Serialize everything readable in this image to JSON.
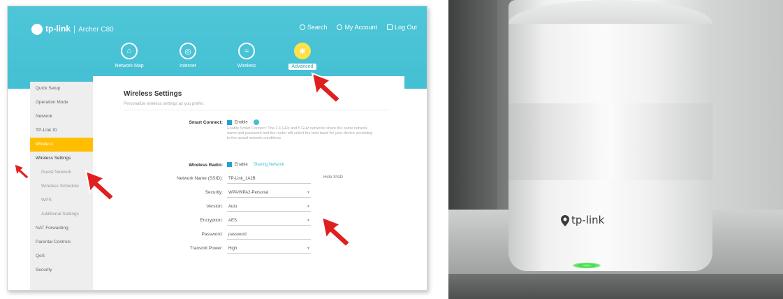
{
  "router_ui": {
    "brand": "tp-link",
    "model": "Archer C80",
    "top_actions": [
      "Search",
      "My Account",
      "Log Out"
    ],
    "tabs": [
      {
        "label": "Network Map"
      },
      {
        "label": "Internet"
      },
      {
        "label": "Wireless"
      },
      {
        "label": "Advanced"
      }
    ],
    "sidebar": [
      {
        "label": "Quick Setup"
      },
      {
        "label": "Operation Mode"
      },
      {
        "label": "Network"
      },
      {
        "label": "TP-Link ID"
      },
      {
        "label": "Wireless"
      },
      {
        "label": "Wireless Settings"
      },
      {
        "label": "Guest Network"
      },
      {
        "label": "Wireless Schedule"
      },
      {
        "label": "WPS"
      },
      {
        "label": "Additional Settings"
      },
      {
        "label": "NAT Forwarding"
      },
      {
        "label": "Parental Controls"
      },
      {
        "label": "QoS"
      },
      {
        "label": "Security"
      }
    ],
    "page": {
      "title": "Wireless Settings",
      "subtitle": "Personalize wireless settings as you prefer.",
      "smart_connect_label": "Smart Connect:",
      "smart_connect_check": "Enable",
      "smart_connect_desc": "Enable Smart Connect: The 2.4 GHz and 5 GHz networks share the same network name and password and the router will select the best band for your device according to the actual network conditions.",
      "wireless_radio_label": "Wireless Radio:",
      "wireless_radio_check": "Enable",
      "wireless_radio_link": "Sharing Network",
      "fields": [
        {
          "label": "Network Name (SSID):",
          "value": "TP-Link_1A2B"
        },
        {
          "label": "Security:",
          "value": "WPA/WPA2-Personal"
        },
        {
          "label": "Version:",
          "value": "Auto"
        },
        {
          "label": "Encryption:",
          "value": "AES"
        },
        {
          "label": "Password:",
          "value": "password"
        },
        {
          "label": "Transmit Power:",
          "value": "High"
        }
      ],
      "hide_ssid": "Hide SSID"
    }
  },
  "device_photo": {
    "logo_text": "tp-link"
  },
  "colors": {
    "header": "#44bfd3",
    "active_tab": "#ffe14a",
    "active_sidebar": "#ffbf00",
    "arrow": "#e02020"
  }
}
